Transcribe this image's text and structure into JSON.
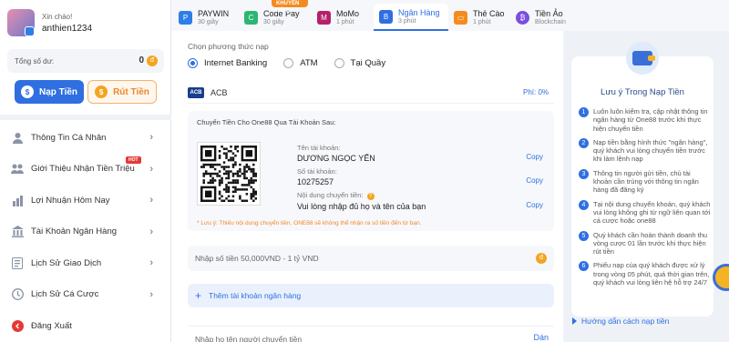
{
  "user": {
    "greeting": "Xin chào!",
    "username": "anthien1234"
  },
  "balance": {
    "label": "Tổng số dư:",
    "value": "0",
    "coin_icon": "coin-icon"
  },
  "actions": {
    "deposit": "Nạp Tiền",
    "withdraw": "Rút Tiền"
  },
  "menu": [
    {
      "label": "Thông Tin Cá Nhân",
      "icon": "user-icon"
    },
    {
      "label": "Giới Thiệu Nhận Tiền Triệu",
      "icon": "referral-icon",
      "badge": "HOT"
    },
    {
      "label": "Lợi Nhuận Hôm Nay",
      "icon": "profit-icon"
    },
    {
      "label": "Tài Khoản Ngân Hàng",
      "icon": "bank-icon"
    },
    {
      "label": "Lịch Sử Giao Dịch",
      "icon": "history-icon"
    },
    {
      "label": "Lịch Sử Cá Cược",
      "icon": "bet-history-icon"
    },
    {
      "label": "Đăng Xuất",
      "icon": "logout-icon"
    }
  ],
  "tabs": [
    {
      "name": "PAYWIN",
      "time": "30 giây",
      "icon": "paywin-icon",
      "color": "#2f7ee8"
    },
    {
      "name": "Code Pay",
      "time": "30 giây",
      "icon": "codepay-icon",
      "color": "#2bb673",
      "promo": "KHUYẾN DÙNG"
    },
    {
      "name": "MoMo",
      "time": "1 phút",
      "icon": "momo-icon",
      "color": "#b5206a"
    },
    {
      "name": "Ngân Hàng",
      "time": "3 phút",
      "icon": "bank-tab-icon",
      "color": "#2f6fe0",
      "active": true
    },
    {
      "name": "Thẻ Cào",
      "time": "1 phút",
      "icon": "card-icon",
      "color": "#f58b1f"
    },
    {
      "name": "Tiền Ảo",
      "time": "Blockchain",
      "icon": "crypto-icon",
      "color": "#7b4fe0"
    }
  ],
  "deposit": {
    "method_title": "Chọn phương thức nạp",
    "methods": [
      "Internet Banking",
      "ATM",
      "Tại Quầy"
    ],
    "bank": {
      "logo": "ACB",
      "name": "ACB",
      "fee": "Phí: 0%"
    },
    "transfer_title": "Chuyển Tiền Cho One88 Qua Tài Khoản Sau:",
    "account_name_label": "Tên tài khoản:",
    "account_name": "DƯƠNG NGỌC YẾN",
    "account_number_label": "Số tài khoản:",
    "account_number": "10275257",
    "content_label": "Nội dung chuyển tiền:",
    "content_value": "Vui lòng nhập đủ họ và tên của bạn",
    "copy": "Copy",
    "note": "* Lưu ý: Thiếu nội dung chuyển tiền, ONE88 sẽ không thể nhận ra số tiền đến từ bạn.",
    "amount_placeholder": "Nhập số tiền 50,000VND - 1 tỷ VND",
    "add_bank": "Thêm tài khoản ngân hàng",
    "sender_placeholder": "Nhập họ tên người chuyển tiền",
    "paste": "Dán"
  },
  "notes": {
    "title": "Lưu ý Trong Nạp Tiền",
    "items": [
      "Luôn luôn kiểm tra, cập nhật thông tin ngân hàng từ One88 trước khi thực hiện chuyển tiền",
      "Nạp tiền bằng hình thức \"ngân hàng\", quý khách vui lòng chuyển tiền trước khi làm lệnh nạp",
      "Thông tin người gửi tiền, chủ tài khoản cần trùng với thông tin ngân hàng đã đăng ký",
      "Tại nội dung chuyển khoản, quý khách vui lòng không ghi từ ngữ liên quan tới cá cược hoặc one88",
      "Quý khách cần hoàn thành doanh thu vòng cược 01 lần trước khi thực hiện rút tiền",
      "Phiếu nạp của quý khách được xử lý trong vòng 05 phút, quá thời gian trên, quý khách vui lòng liên hệ hỗ trợ 24/7"
    ],
    "guide": "Hướng dẫn cách nạp tiền"
  }
}
